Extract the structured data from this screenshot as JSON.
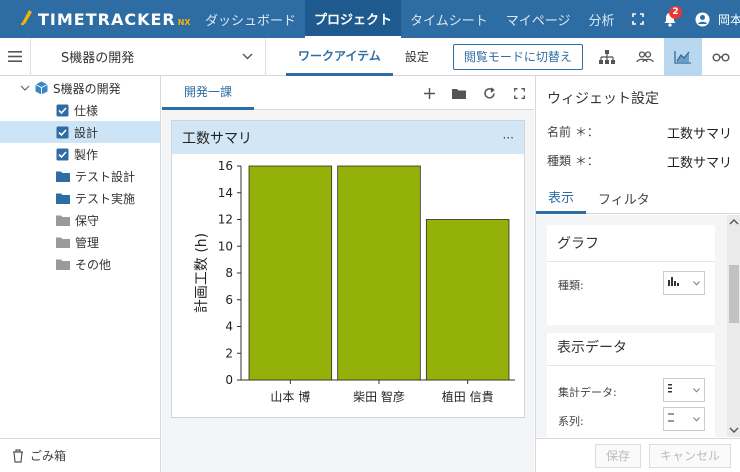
{
  "app": {
    "logo_text": "TIMETRACKER",
    "logo_suffix": "NX"
  },
  "nav": {
    "tabs": [
      "ダッシュボード",
      "プロジェクト",
      "タイムシート",
      "マイページ",
      "分析"
    ],
    "active_tab": "プロジェクト",
    "notification_count": "2",
    "user_name": "岡本"
  },
  "subbar": {
    "project_name": "S機器の開発",
    "tabs": [
      "ワークアイテム",
      "設定"
    ],
    "mode_button": "閲覧モードに切替え"
  },
  "tree": {
    "root": "S機器の開発",
    "items": [
      {
        "label": "仕様",
        "icon": "task-check-icon"
      },
      {
        "label": "設計",
        "icon": "task-check-icon",
        "selected": true
      },
      {
        "label": "製作",
        "icon": "task-check-icon"
      },
      {
        "label": "テスト設計",
        "icon": "folder-blue-icon"
      },
      {
        "label": "テスト実施",
        "icon": "folder-blue-icon"
      },
      {
        "label": "保守",
        "icon": "folder-gray-icon"
      },
      {
        "label": "管理",
        "icon": "folder-gray-icon"
      },
      {
        "label": "その他",
        "icon": "folder-gray-icon"
      }
    ],
    "trash": "ごみ箱"
  },
  "center": {
    "tab": "開発一課",
    "widget_title": "工数サマリ",
    "widget_menu": "···"
  },
  "chart_data": {
    "type": "bar",
    "categories": [
      "山本 博",
      "柴田 智彦",
      "植田 信貴"
    ],
    "values": [
      16,
      16,
      12
    ],
    "ylabel": "計画工数 (h)",
    "ylim": [
      0,
      16
    ],
    "yticks": [
      0,
      2,
      4,
      6,
      8,
      10,
      12,
      14,
      16
    ],
    "bar_color": "#94b10a",
    "grid": false
  },
  "right_panel": {
    "title": "ウィジェット設定",
    "name_label": "名前 ＊：",
    "name_value": "工数サマリ",
    "type_label": "種類 ＊：",
    "type_value": "工数サマリ",
    "tabs": [
      "表示",
      "フィルタ"
    ],
    "graph_section": "グラフ",
    "graph_type_label": "種類:",
    "data_section": "表示データ",
    "agg_label": "集計データ:",
    "series_label": "系列:",
    "save": "保存",
    "cancel": "キャンセル"
  },
  "colors": {
    "nav_bg": "#2d6da3",
    "accent": "#2d6da3",
    "bar": "#94b10a",
    "selected_bg": "#cde3f6",
    "widget_header": "#d3e6f5"
  }
}
